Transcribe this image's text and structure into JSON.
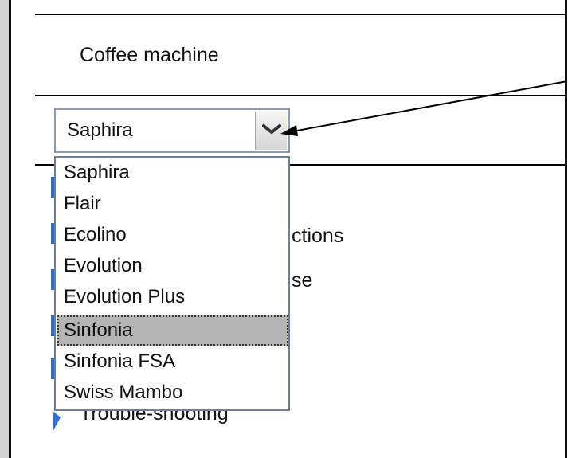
{
  "section": {
    "title": "Coffee machine"
  },
  "combo": {
    "value": "Saphira",
    "icon": "chevron-down-icon"
  },
  "options": [
    {
      "label": "Saphira",
      "selected": false
    },
    {
      "label": "Flair",
      "selected": false
    },
    {
      "label": "Ecolino",
      "selected": false
    },
    {
      "label": "Evolution",
      "selected": false
    },
    {
      "label": "Evolution Plus",
      "selected": false
    },
    {
      "label": "Sinfonia",
      "selected": true
    },
    {
      "label": "Sinfonia FSA",
      "selected": false
    },
    {
      "label": "Swiss Mambo",
      "selected": false
    }
  ],
  "underlying": {
    "line1": "ctions",
    "line2": "se",
    "line3": "Trouble-shooting"
  },
  "colors": {
    "accent": "#2f6fd6",
    "selection": "#b5b5b5",
    "border": "#6d7f95"
  }
}
